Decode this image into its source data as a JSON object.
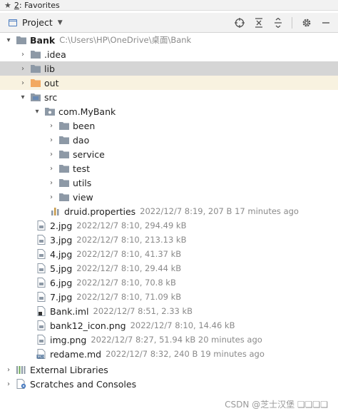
{
  "favorites": {
    "number": "2",
    "label": ": Favorites"
  },
  "toolbar": {
    "title": "Project",
    "icons": [
      "crosshair-icon",
      "collapse-all-icon",
      "expand-all-icon",
      "gear-icon",
      "minimize-icon"
    ]
  },
  "colors": {
    "selection": "#d5d5d5",
    "folder": "#8d99a6",
    "excluded_folder": "#f2a860",
    "meta_text": "#8a8a8a",
    "source_folder": "#4a7cc0"
  },
  "tree": {
    "root": {
      "name": "Bank",
      "path": "C:\\Users\\HP\\OneDrive\\桌面\\Bank"
    },
    "idea": ".idea",
    "lib": "lib",
    "out": "out",
    "src": "src",
    "package": "com.MyBank",
    "packages": [
      "been",
      "dao",
      "service",
      "test",
      "utils",
      "view"
    ],
    "druid": {
      "name": "druid.properties",
      "meta": "2022/12/7 8:19, 207 B 17 minutes ago"
    },
    "files": [
      {
        "name": "2.jpg",
        "meta": "2022/12/7 8:10, 294.49 kB"
      },
      {
        "name": "3.jpg",
        "meta": "2022/12/7 8:10, 213.13 kB"
      },
      {
        "name": "4.jpg",
        "meta": "2022/12/7 8:10, 41.37 kB"
      },
      {
        "name": "5.jpg",
        "meta": "2022/12/7 8:10, 29.44 kB"
      },
      {
        "name": "6.jpg",
        "meta": "2022/12/7 8:10, 70.8 kB"
      },
      {
        "name": "7.jpg",
        "meta": "2022/12/7 8:10, 71.09 kB"
      },
      {
        "name": "Bank.iml",
        "meta": "2022/12/7 8:51, 2.33 kB"
      },
      {
        "name": "bank12_icon.png",
        "meta": "2022/12/7 8:10, 14.46 kB"
      },
      {
        "name": "img.png",
        "meta": "2022/12/7 8:27, 51.94 kB 20 minutes ago"
      },
      {
        "name": "redame.md",
        "meta": "2022/12/7 8:32, 240 B 19 minutes ago"
      }
    ],
    "external_libraries": "External Libraries",
    "scratches": "Scratches and Consoles"
  },
  "watermark": "CSDN @芝士汉堡 ❏❏❏❏"
}
